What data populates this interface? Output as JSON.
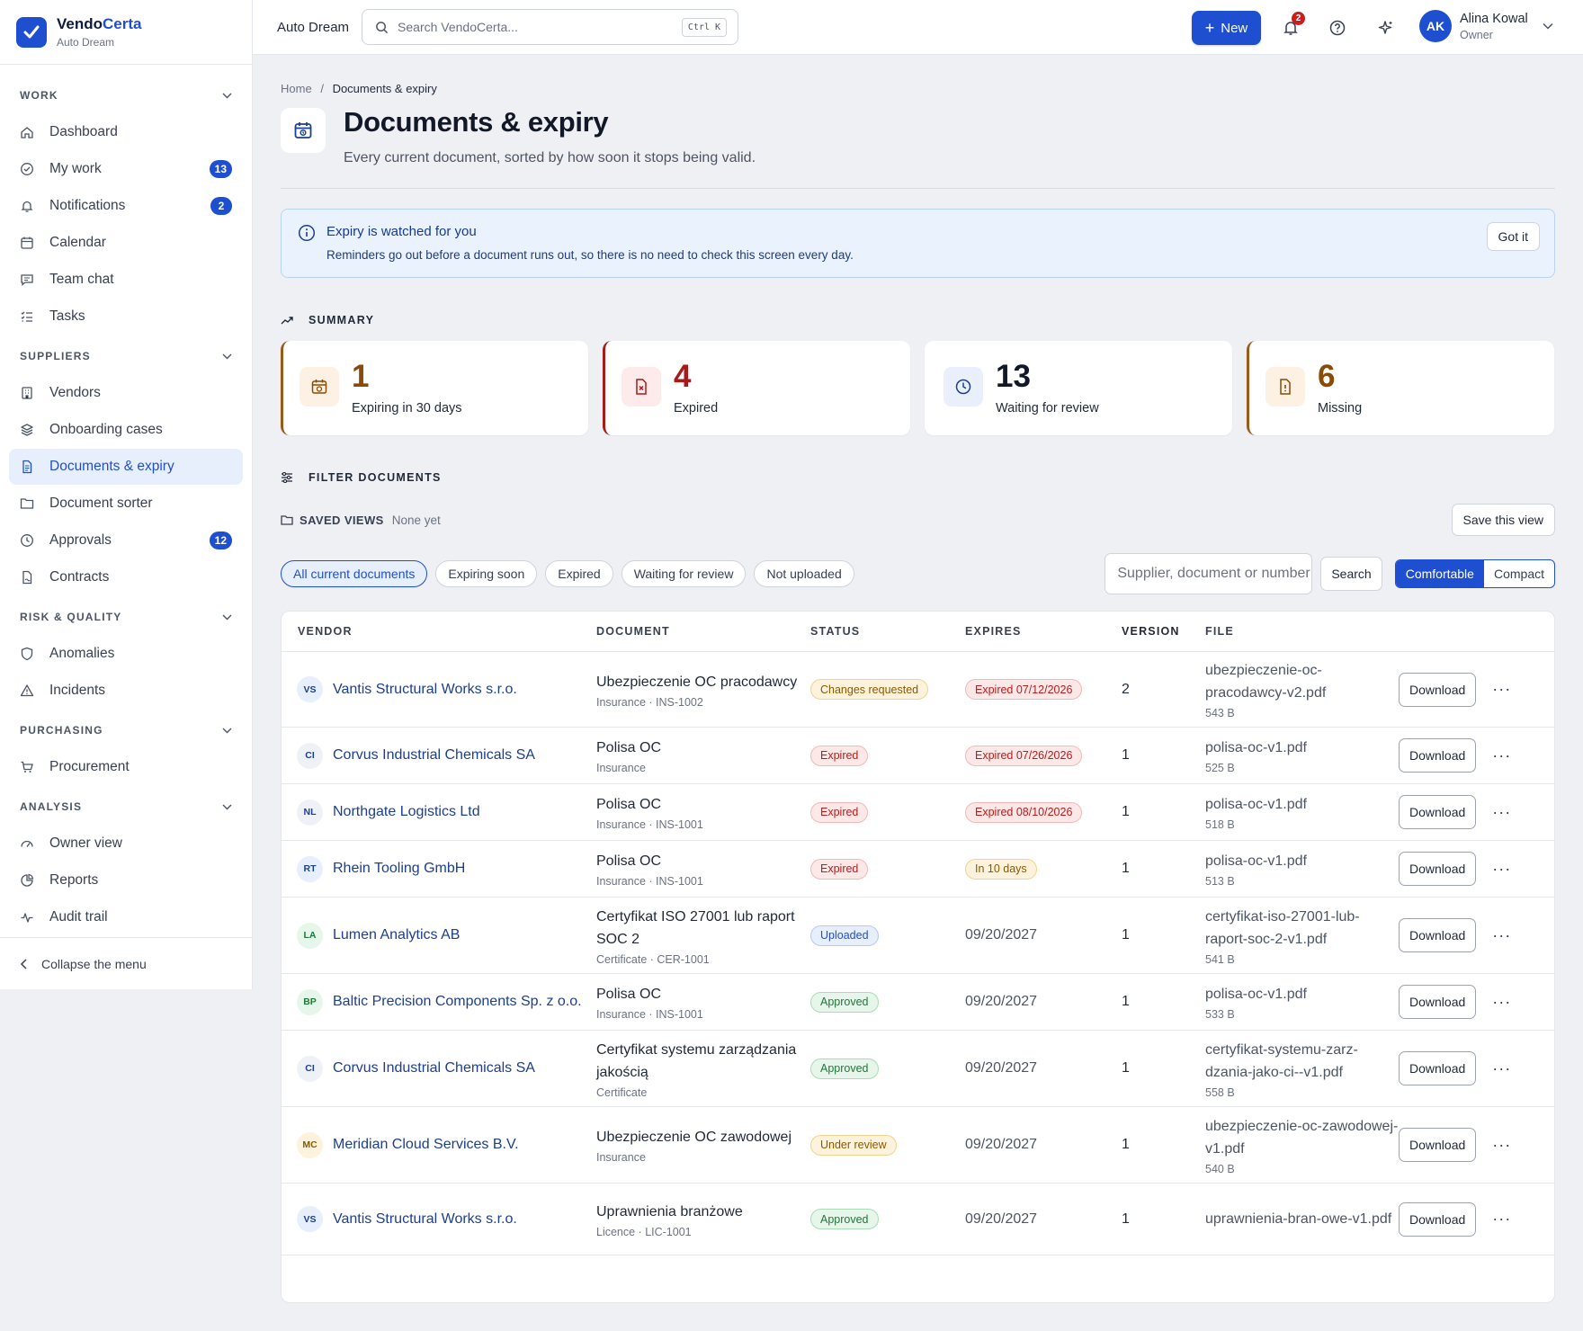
{
  "brand": {
    "name_a": "Vendo",
    "name_b": "Certa",
    "org": "Auto Dream"
  },
  "sidebar": {
    "sections": [
      {
        "title": "WORK",
        "items": [
          {
            "label": "Dashboard",
            "icon": "home-icon"
          },
          {
            "label": "My work",
            "icon": "check-circle-icon",
            "badge": "13"
          },
          {
            "label": "Notifications",
            "icon": "bell-icon",
            "badge": "2"
          },
          {
            "label": "Calendar",
            "icon": "calendar-icon"
          },
          {
            "label": "Team chat",
            "icon": "chat-icon"
          },
          {
            "label": "Tasks",
            "icon": "list-check-icon"
          }
        ]
      },
      {
        "title": "SUPPLIERS",
        "items": [
          {
            "label": "Vendors",
            "icon": "building-icon"
          },
          {
            "label": "Onboarding cases",
            "icon": "layers-icon"
          },
          {
            "label": "Documents & expiry",
            "icon": "document-icon",
            "active": true
          },
          {
            "label": "Document sorter",
            "icon": "folder-icon"
          },
          {
            "label": "Approvals",
            "icon": "clock-icon",
            "badge": "12"
          },
          {
            "label": "Contracts",
            "icon": "contract-icon"
          }
        ]
      },
      {
        "title": "RISK & QUALITY",
        "items": [
          {
            "label": "Anomalies",
            "icon": "shield-icon"
          },
          {
            "label": "Incidents",
            "icon": "warning-icon"
          }
        ]
      },
      {
        "title": "PURCHASING",
        "items": [
          {
            "label": "Procurement",
            "icon": "cart-icon"
          }
        ]
      },
      {
        "title": "ANALYSIS",
        "items": [
          {
            "label": "Owner view",
            "icon": "gauge-icon"
          },
          {
            "label": "Reports",
            "icon": "chart-pie-icon"
          },
          {
            "label": "Audit trail",
            "icon": "activity-icon"
          }
        ]
      }
    ],
    "collapse_label": "Collapse the menu"
  },
  "topbar": {
    "org": "Auto Dream",
    "search_placeholder": "Search VendoCerta...",
    "shortcut": "Ctrl K",
    "new_label": "New",
    "notif_count": "2",
    "user": {
      "initials": "AK",
      "name": "Alina Kowal",
      "role": "Owner"
    }
  },
  "page": {
    "crumb_home": "Home",
    "crumb_sep": "/",
    "crumb_current": "Documents & expiry",
    "title": "Documents & expiry",
    "subtitle": "Every current document, sorted by how soon it stops being valid."
  },
  "info": {
    "title": "Expiry is watched for you",
    "text": "Reminders go out before a document runs out, so there is no need to check this screen every day.",
    "button": "Got it"
  },
  "summary": {
    "label": "SUMMARY",
    "cards": [
      {
        "value": "1",
        "label": "Expiring in 30 days",
        "color": "#8a4b08",
        "bg": "#fdf1e3",
        "border": "#9a5a1a",
        "icon": "calendar-clock-icon"
      },
      {
        "value": "4",
        "label": "Expired",
        "color": "#a61b1b",
        "bg": "#fdeaea",
        "border": "#a61b1b",
        "icon": "document-x-icon"
      },
      {
        "value": "13",
        "label": "Waiting for review",
        "color": "#111827",
        "bg": "#eaf0fb",
        "border": "transparent",
        "icon": "clock-icon"
      },
      {
        "value": "6",
        "label": "Missing",
        "color": "#8a4b08",
        "bg": "#fdf1e3",
        "border": "#9a5a1a",
        "icon": "document-missing-icon"
      }
    ]
  },
  "filters": {
    "label": "FILTER DOCUMENTS",
    "saved_label": "SAVED VIEWS",
    "saved_value": "None yet",
    "save_view": "Save this view",
    "chips": [
      "All current documents",
      "Expiring soon",
      "Expired",
      "Waiting for review",
      "Not uploaded"
    ],
    "input_placeholder": "Supplier, document or number",
    "search_label": "Search",
    "density": [
      "Comfortable",
      "Compact"
    ]
  },
  "table": {
    "headers": [
      "VENDOR",
      "DOCUMENT",
      "STATUS",
      "EXPIRES",
      "VERSION",
      "FILE"
    ],
    "download_label": "Download",
    "more_label": "···",
    "rows": [
      {
        "initials": "VS",
        "vendor": "Vantis Structural Works s.r.o.",
        "doc": "Ubezpieczenie OC pracodawcy",
        "doc_sub": "Insurance · INS-1002",
        "status": "Changes requested",
        "status_kind": "changes",
        "expires": "Expired 07/12/2026",
        "expires_kind": "expired",
        "version": "2",
        "file": "ubezpieczenie-oc-pracodawcy-v2.pdf",
        "size": "543 B"
      },
      {
        "initials": "CI",
        "vendor": "Corvus Industrial Chemicals SA",
        "doc": "Polisa OC",
        "doc_sub": "Insurance",
        "status": "Expired",
        "status_kind": "expired",
        "expires": "Expired 07/26/2026",
        "expires_kind": "expired",
        "version": "1",
        "file": "polisa-oc-v1.pdf",
        "size": "525 B"
      },
      {
        "initials": "NL",
        "vendor": "Northgate Logistics Ltd",
        "doc": "Polisa OC",
        "doc_sub": "Insurance · INS-1001",
        "status": "Expired",
        "status_kind": "expired",
        "expires": "Expired 08/10/2026",
        "expires_kind": "expired",
        "version": "1",
        "file": "polisa-oc-v1.pdf",
        "size": "518 B"
      },
      {
        "initials": "RT",
        "vendor": "Rhein Tooling GmbH",
        "doc": "Polisa OC",
        "doc_sub": "Insurance · INS-1001",
        "status": "Expired",
        "status_kind": "expired",
        "expires": "In 10 days",
        "expires_kind": "soon",
        "version": "1",
        "file": "polisa-oc-v1.pdf",
        "size": "513 B"
      },
      {
        "initials": "LA",
        "vendor": "Lumen Analytics AB",
        "doc": "Certyfikat ISO 27001 lub raport SOC 2",
        "doc_sub": "Certificate · CER-1001",
        "status": "Uploaded",
        "status_kind": "uploaded",
        "expires": "09/20/2027",
        "expires_kind": "plain",
        "version": "1",
        "file": "certyfikat-iso-27001-lub-raport-soc-2-v1.pdf",
        "size": "541 B"
      },
      {
        "initials": "BP",
        "vendor": "Baltic Precision Components Sp. z o.o.",
        "doc": "Polisa OC",
        "doc_sub": "Insurance · INS-1001",
        "status": "Approved",
        "status_kind": "approved",
        "expires": "09/20/2027",
        "expires_kind": "plain",
        "version": "1",
        "file": "polisa-oc-v1.pdf",
        "size": "533 B"
      },
      {
        "initials": "CI",
        "vendor": "Corvus Industrial Chemicals SA",
        "doc": "Certyfikat systemu zarządzania jakością",
        "doc_sub": "Certificate",
        "status": "Approved",
        "status_kind": "approved",
        "expires": "09/20/2027",
        "expires_kind": "plain",
        "version": "1",
        "file": "certyfikat-systemu-zarz-dzania-jako-ci--v1.pdf",
        "size": "558 B"
      },
      {
        "initials": "MC",
        "vendor": "Meridian Cloud Services B.V.",
        "doc": "Ubezpieczenie OC zawodowej",
        "doc_sub": "Insurance",
        "status": "Under review",
        "status_kind": "review",
        "expires": "09/20/2027",
        "expires_kind": "plain",
        "version": "1",
        "file": "ubezpieczenie-oc-zawodowej-v1.pdf",
        "size": "540 B"
      },
      {
        "initials": "VS",
        "vendor": "Vantis Structural Works s.r.o.",
        "doc": "Uprawnienia branżowe",
        "doc_sub": "Licence · LIC-1001",
        "status": "Approved",
        "status_kind": "approved",
        "expires": "09/20/2027",
        "expires_kind": "plain",
        "version": "1",
        "file": "uprawnienia-bran-owe-v1.pdf",
        "size": ""
      }
    ]
  }
}
